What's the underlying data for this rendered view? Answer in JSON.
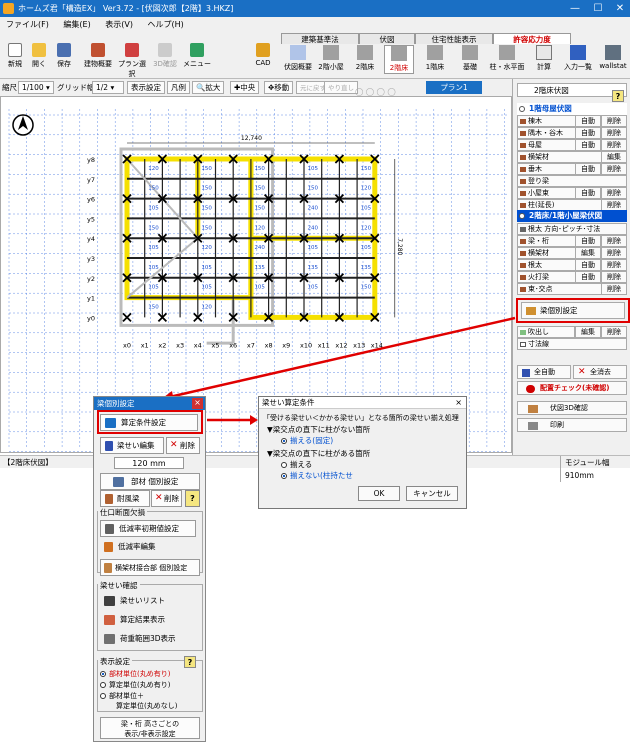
{
  "window": {
    "title": "ホームズ君「構造EX」 Ver3.72 - [伏図次郎【2階】3.HKZ]",
    "min": "—",
    "max": "☐",
    "close": "✕"
  },
  "menu": [
    "ファイル(F)",
    "編集(E)",
    "表示(V)",
    "ヘルプ(H)"
  ],
  "toolbar": {
    "left": [
      {
        "label": "新規",
        "icon": "new-file-icon",
        "color": "#ffffff"
      },
      {
        "label": "開く",
        "icon": "open-folder-icon",
        "color": "#f0c040"
      },
      {
        "label": "保存",
        "icon": "save-icon",
        "color": "#4a6fb0"
      },
      {
        "label": "建物概要",
        "icon": "house-icon",
        "color": "#c05030"
      },
      {
        "label": "プラン選択",
        "icon": "plan-icon",
        "color": "#d04040"
      },
      {
        "label": "3D確認",
        "icon": "3d-icon",
        "color": "#cccccc"
      },
      {
        "label": "メニュー",
        "icon": "menu-icon",
        "color": "#30a060"
      },
      {
        "label": "CAD",
        "icon": "cad-icon",
        "color": "#e0a020"
      }
    ],
    "tabs": [
      "建築基準法",
      "伏図",
      "住宅性能表示",
      "許容応力度"
    ],
    "tools": [
      "伏図概要",
      "2階小屋",
      "2階床",
      "2階床",
      "1階床",
      "基礎",
      "柱・水平面",
      "計算",
      "入力一覧",
      "wallstat"
    ]
  },
  "toolbar2": {
    "scale_label": "縮尺",
    "scale": "1/100",
    "grid_label": "グリッド幅",
    "grid": "1/2",
    "display": "表示設定",
    "legend": "凡例",
    "zoom": "拡大",
    "center": "中央",
    "move": "移動",
    "undo": "元に戻す",
    "redo": "やり直し",
    "radios": [
      "",
      "",
      "",
      ""
    ],
    "plan": "プラン1"
  },
  "canvas": {
    "dimension_top": "12,740",
    "dimension_right": "7,280",
    "x_labels": [
      "x0",
      "x1",
      "x2",
      "x3",
      "x4",
      "x5",
      "x6",
      "x7",
      "x8",
      "x9",
      "x10",
      "x11",
      "x12",
      "x13",
      "x14"
    ],
    "y_labels": [
      "y8",
      "y7",
      "y6",
      "y5",
      "y4",
      "y3",
      "y2",
      "y1",
      "y0"
    ],
    "beam_values": [
      "120",
      "150",
      "150",
      "105",
      "150",
      "150",
      "150",
      "150",
      "150",
      "120",
      "105",
      "150",
      "150",
      "240",
      "105",
      "150",
      "150",
      "120",
      "240",
      "120",
      "105",
      "120",
      "240",
      "105",
      "105",
      "105",
      "105",
      "135",
      "135",
      "135",
      "105",
      "105",
      "105",
      "105",
      "150",
      "150",
      "120"
    ]
  },
  "rpanel": {
    "title": "2階床伏図",
    "help": "?",
    "section1": "1階母屋伏図",
    "roof_items": [
      {
        "label": "棟木",
        "sub": [
          "自動",
          "削除"
        ]
      },
      {
        "label": "隅木・谷木",
        "sub": [
          "自動",
          "削除"
        ]
      },
      {
        "label": "母屋",
        "sub": [
          "自動",
          "削除"
        ]
      },
      {
        "label": "横架材",
        "sub": [
          "編集"
        ]
      },
      {
        "label": "垂木",
        "sub": [
          "自動",
          "削除"
        ]
      },
      {
        "label": "登り梁",
        "sub": []
      },
      {
        "label": "小屋束",
        "sub": [
          "自動",
          "削除"
        ]
      },
      {
        "label": "柱(延長)",
        "sub": [
          "削除"
        ]
      }
    ],
    "section2": "2階床/1階小屋梁伏図",
    "spacing": "根太 方向･ピッチ･寸法",
    "floor_items": [
      {
        "label": "梁・桁",
        "sub": [
          "自動",
          "削除"
        ]
      },
      {
        "label": "横架材",
        "sub": [
          "編集",
          "削除"
        ]
      },
      {
        "label": "根太",
        "sub": [
          "自動",
          "削除"
        ]
      },
      {
        "label": "火打梁",
        "sub": [
          "自動",
          "削除"
        ]
      },
      {
        "label": "束･交点",
        "sub": [
          "削除"
        ]
      }
    ],
    "beam_setting": "梁個別設定",
    "fukidashi": "吹出し",
    "fuki_edit": "編集",
    "fuki_del": "削除",
    "dim_line": "寸法線",
    "auto_all": "全自動",
    "clear_all": "全消去",
    "check": "配置チェック(未確認)",
    "view3d": "伏図3D確認",
    "print": "印刷"
  },
  "status": {
    "left": "【2階床伏図】",
    "right": "モジュール幅910mm"
  },
  "leftpanel": {
    "title": "梁個別設定",
    "close": "×",
    "calc_cond": "算定条件設定",
    "beam_edit": "梁せい編集",
    "delete": "削除",
    "size": "120 mm",
    "member": "部材 個別設定",
    "resist": "耐風梁",
    "resist_del": "削除",
    "help": "?",
    "notch_section": "仕口断面欠損",
    "reduce_set": "低減率初期値設定",
    "reduce_edit": "低減率編集",
    "joint_set": "横架材接合部 個別設定",
    "check_section": "梁せい確認",
    "list": "梁せいリスト",
    "result": "算定結果表示",
    "range3d": "荷重範囲3D表示",
    "disp_section": "表示設定",
    "disp_help": "?",
    "opt1": "部材単位(丸め有り)",
    "opt2": "算定単位(丸め有り)",
    "opt3a": "部材単位＋",
    "opt3b": "算定単位(丸めなし)",
    "bottom1": "梁・桁 高さごとの",
    "bottom2": "表示/非表示設定"
  },
  "dialog": {
    "title": "梁せい算定条件",
    "close": "×",
    "line1": "「受ける梁せい＜かかる梁せい」となる箇所の梁せい揃え処理",
    "case1": "▼梁交点の直下に柱がない箇所",
    "case1_opt": "揃える(固定)",
    "case2": "▼梁交点の直下に柱がある箇所",
    "case2_opt1": "揃える",
    "case2_opt2": "揃えない(柱持たせ",
    "ok": "OK",
    "cancel": "キャンセル"
  },
  "colors": {
    "highlight": "#e00000",
    "beam_yellow": "#f5e000",
    "grid_blue": "#3a6ee0",
    "title_blue": "#1a6fc4",
    "section_blue": "#0050d0"
  }
}
